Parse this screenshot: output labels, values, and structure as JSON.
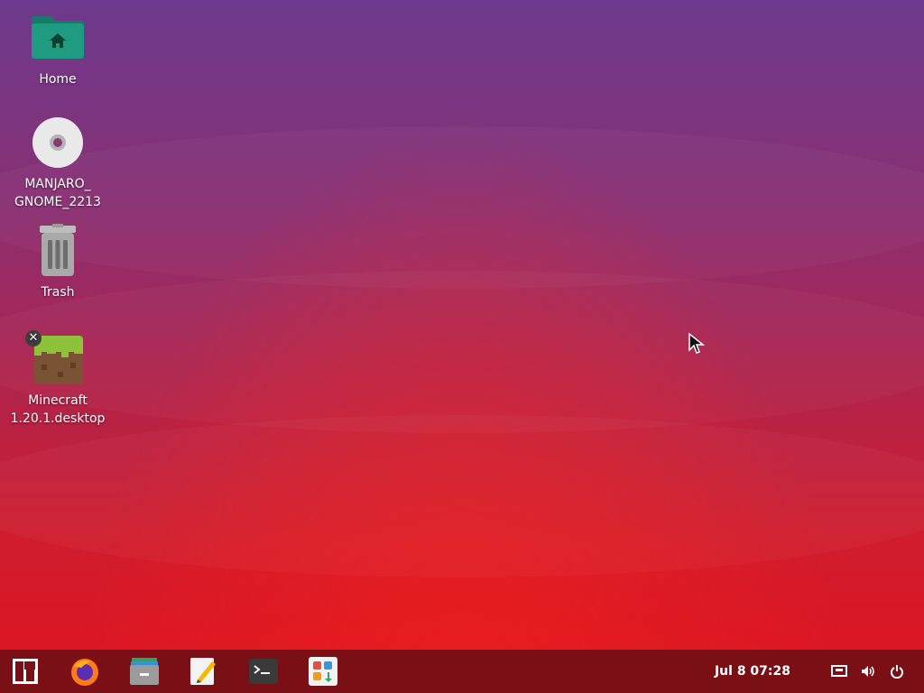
{
  "desktop": {
    "icons": [
      {
        "name": "home-folder",
        "label": "Home"
      },
      {
        "name": "disc",
        "label": "MANJARO_\nGNOME_2213"
      },
      {
        "name": "trash",
        "label": "Trash"
      },
      {
        "name": "minecraft",
        "label": "Minecraft\n1.20.1.desktop"
      }
    ]
  },
  "taskbar": {
    "apps": [
      {
        "name": "manjaro-menu"
      },
      {
        "name": "firefox"
      },
      {
        "name": "files"
      },
      {
        "name": "text-editor"
      },
      {
        "name": "terminal"
      },
      {
        "name": "software-center"
      }
    ],
    "clock": "Jul 8  07:28",
    "tray": [
      "network-icon",
      "volume-icon",
      "power-icon"
    ]
  },
  "colors": {
    "taskbar_bg": "#7a0f16",
    "folder_teal": "#1b8c75",
    "wallpaper_top": "#6c3a8e",
    "wallpaper_bottom": "#e1141f"
  }
}
